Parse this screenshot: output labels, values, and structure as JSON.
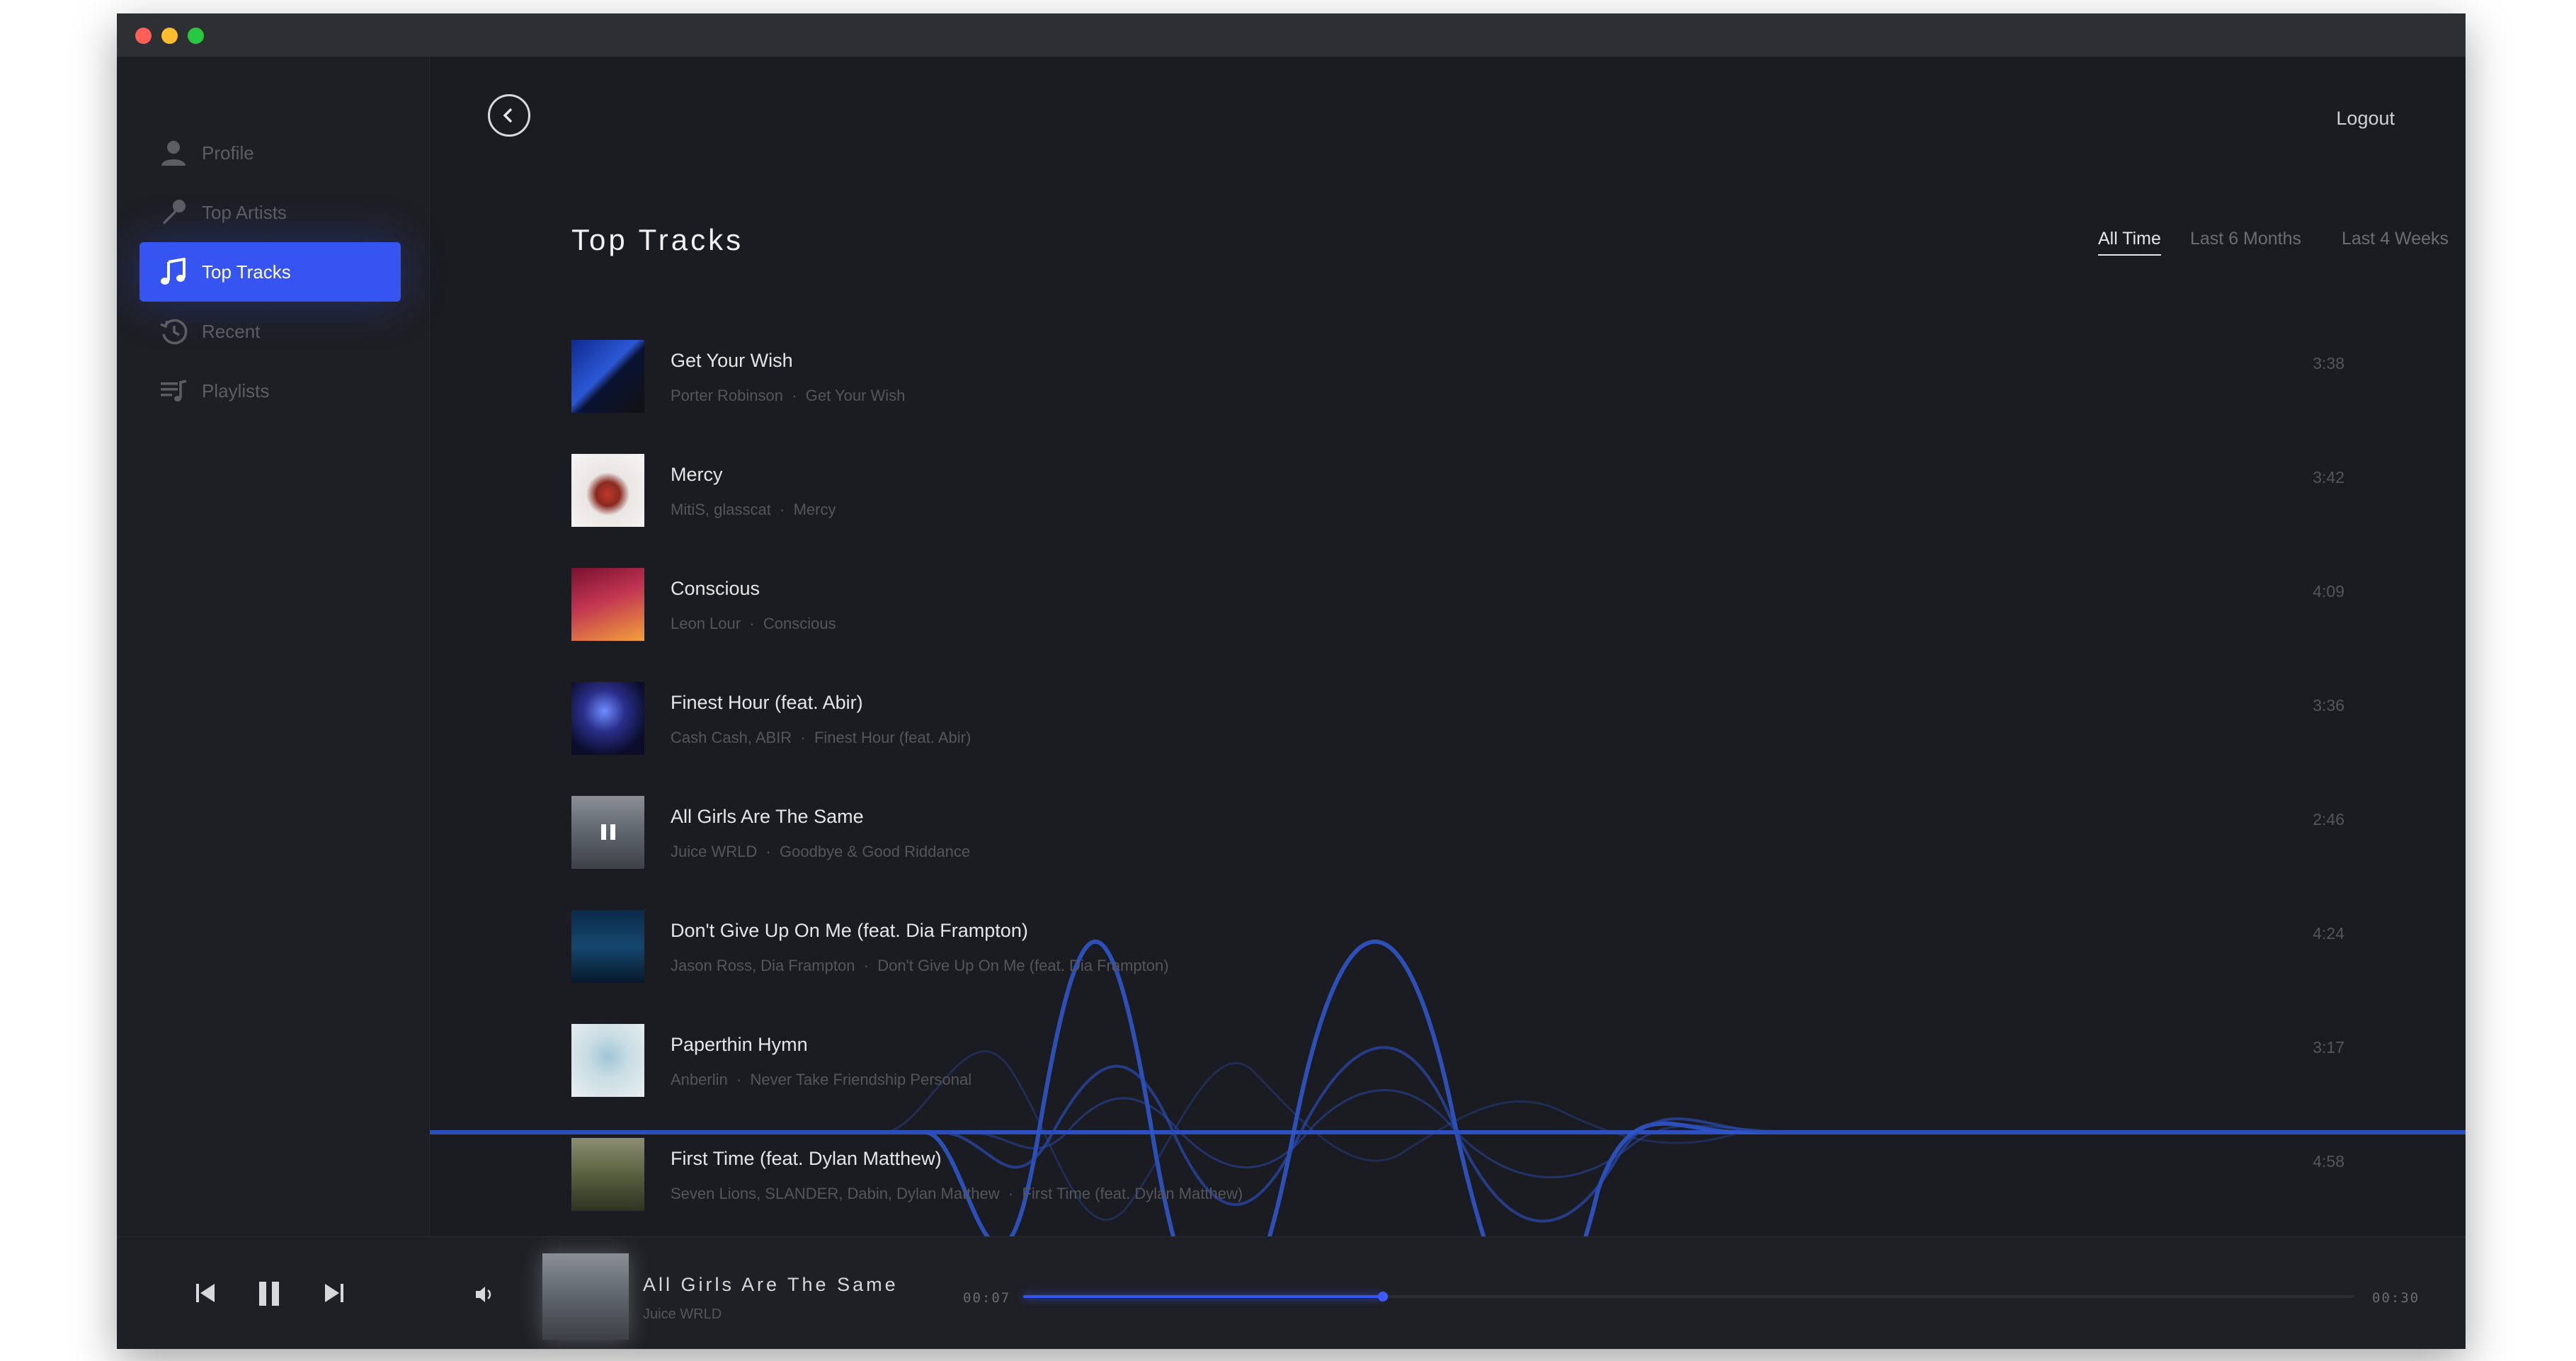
{
  "sidebar": {
    "items": [
      {
        "label": "Profile",
        "icon": "user-icon"
      },
      {
        "label": "Top Artists",
        "icon": "microphone-icon"
      },
      {
        "label": "Top Tracks",
        "icon": "music-note-icon",
        "active": true
      },
      {
        "label": "Recent",
        "icon": "history-icon"
      },
      {
        "label": "Playlists",
        "icon": "playlist-icon"
      }
    ]
  },
  "header": {
    "back_icon": "chevron-left-icon",
    "logout_label": "Logout"
  },
  "main": {
    "title": "Top Tracks",
    "ranges": [
      {
        "label": "All Time",
        "active": true
      },
      {
        "label": "Last 6 Months",
        "active": false
      },
      {
        "label": "Last 4 Weeks",
        "active": false
      }
    ],
    "tracks": [
      {
        "title": "Get Your Wish",
        "artists": "Porter Robinson",
        "album": "Get Your Wish",
        "duration": "3:38"
      },
      {
        "title": "Mercy",
        "artists": "MitiS, glasscat",
        "album": "Mercy",
        "duration": "3:42"
      },
      {
        "title": "Conscious",
        "artists": "Leon Lour",
        "album": "Conscious",
        "duration": "4:09"
      },
      {
        "title": "Finest Hour (feat. Abir)",
        "artists": "Cash Cash, ABIR",
        "album": "Finest Hour (feat. Abir)",
        "duration": "3:36"
      },
      {
        "title": "All Girls Are The Same",
        "artists": "Juice WRLD",
        "album": "Goodbye & Good Riddance",
        "duration": "2:46",
        "playing": true
      },
      {
        "title": "Don't Give Up On Me (feat. Dia Frampton)",
        "artists": "Jason Ross, Dia Frampton",
        "album": "Don't Give Up On Me (feat. Dia Frampton)",
        "duration": "4:24"
      },
      {
        "title": "Paperthin Hymn",
        "artists": "Anberlin",
        "album": "Never Take Friendship Personal",
        "duration": "3:17"
      },
      {
        "title": "First Time (feat. Dylan Matthew)",
        "artists": "Seven Lions, SLANDER, Dabin, Dylan Matthew",
        "album": "First Time (feat. Dylan Matthew)",
        "duration": "4:58"
      }
    ]
  },
  "player": {
    "title": "All Girls Are The Same",
    "artist": "Juice WRLD",
    "elapsed": "00:07",
    "total": "00:30",
    "progress": 0.27,
    "accent": "#3554f2"
  }
}
